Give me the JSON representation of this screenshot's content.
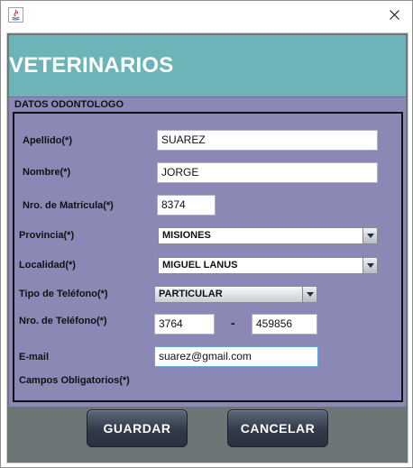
{
  "window": {
    "close_glyph": "✕",
    "app_icon": "java-icon"
  },
  "banner": {
    "title": "VETERINARIOS"
  },
  "form": {
    "legend": "DATOS ODONTOLOGO",
    "apellido": {
      "label": "Apellido(*)",
      "value": "SUAREZ"
    },
    "nombre": {
      "label": "Nombre(*)",
      "value": "JORGE"
    },
    "matricula": {
      "label": "Nro. de Matrícula(*)",
      "value": "8374"
    },
    "provincia": {
      "label": "Provincia(*)",
      "value": "MISIONES"
    },
    "localidad": {
      "label": "Localidad(*)",
      "value": "MIGUEL LANUS"
    },
    "tipo_telefono": {
      "label": "Tipo de Teléfono(*)",
      "value": "PARTICULAR"
    },
    "telefono": {
      "label": "Nro. de Teléfono(*)",
      "area": "3764",
      "separator": "-",
      "number": "459856"
    },
    "email": {
      "label": "E-mail",
      "value": "suarez@gmail.com"
    },
    "required_note": "Campos Obligatorios(*)"
  },
  "buttons": {
    "save": "GUARDAR",
    "cancel": "CANCELAR"
  },
  "colors": {
    "banner": "#6cb4b8",
    "panel": "#8b88b5",
    "footer": "#6d7577",
    "button": "#313a48"
  }
}
